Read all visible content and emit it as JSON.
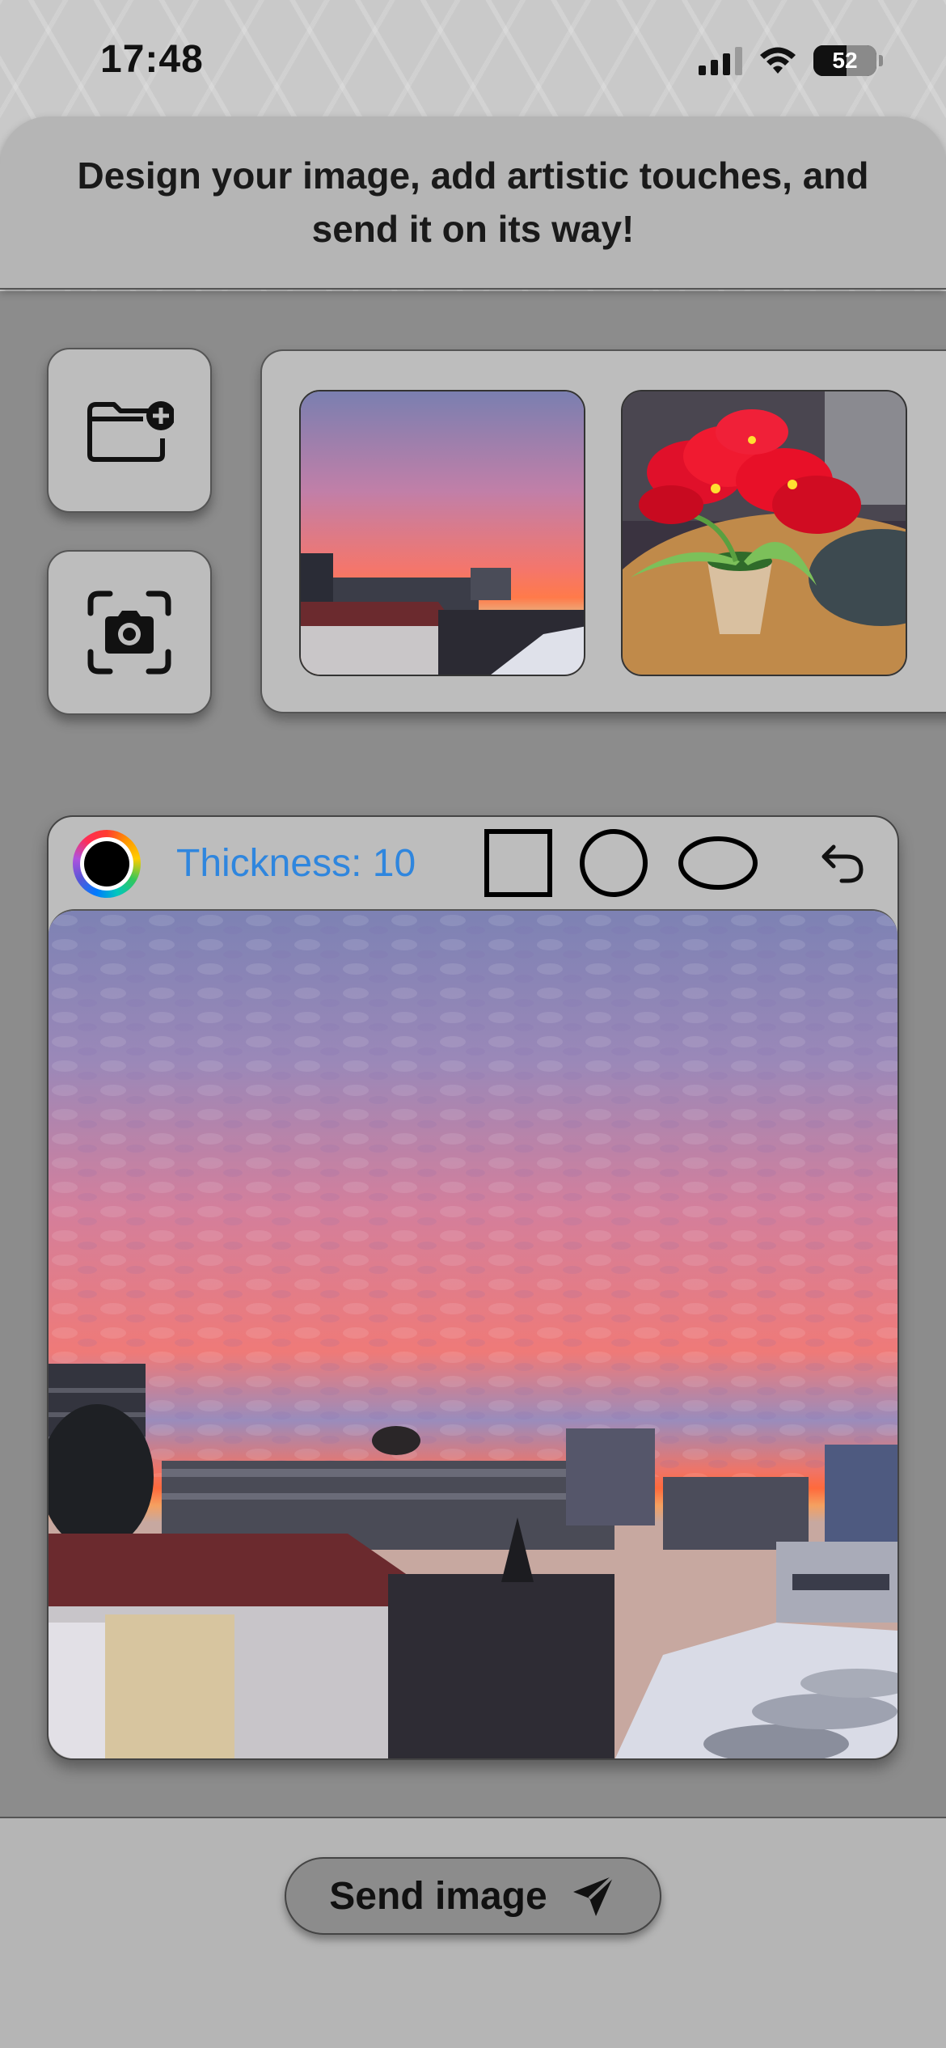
{
  "status_bar": {
    "time": "17:48",
    "battery_percent": "52",
    "battery_level": 0.52,
    "signal_bars_active": 3,
    "icons": [
      "cellular-signal-icon",
      "wifi-icon",
      "battery-icon"
    ]
  },
  "header": {
    "text": "Design your image, add artistic touches, and send it on its way!"
  },
  "sources": {
    "add_folder_icon": "folder-plus-icon",
    "camera_icon": "camera-scan-icon"
  },
  "thumbnails": [
    {
      "subject": "sunset-sky-over-buildings"
    },
    {
      "subject": "red-flowers-in-pot"
    }
  ],
  "editor": {
    "thickness_label": "Thickness: 10",
    "tools": [
      "color-wheel-icon",
      "rectangle-icon",
      "circle-icon",
      "ellipse-icon",
      "undo-icon"
    ],
    "selected_color": "#000000",
    "thickness_color": "#2f86de"
  },
  "footer": {
    "send_label": "Send image",
    "send_icon": "paper-plane-icon"
  }
}
